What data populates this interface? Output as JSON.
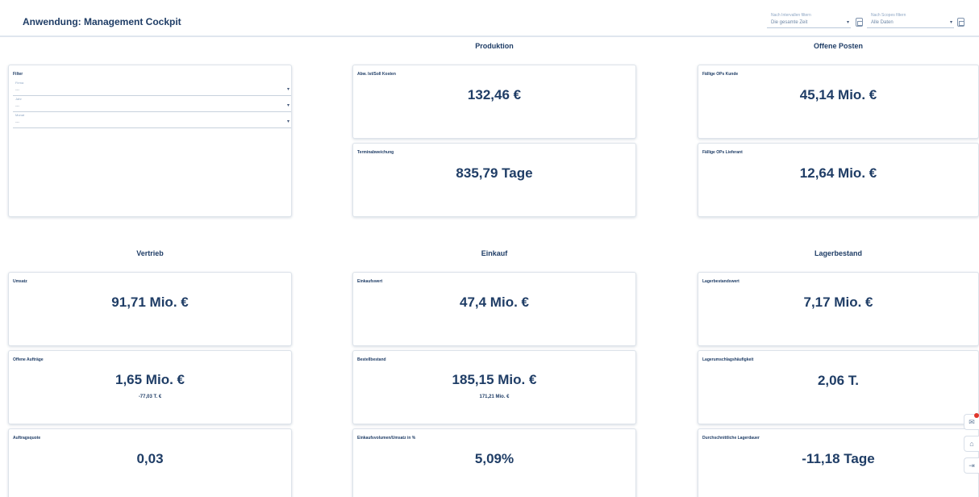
{
  "header": {
    "title": "Anwendung: Management Cockpit",
    "interval_filter": {
      "label": "Nach Intervallen filtern",
      "value": "Die gesamte Zeit"
    },
    "scope_filter": {
      "label": "Nach Scopes filtern",
      "value": "Alle Daten"
    }
  },
  "sections": {
    "produktion": "Produktion",
    "offene_posten": "Offene Posten",
    "vertrieb": "Vertrieb",
    "einkauf": "Einkauf",
    "lagerbestand": "Lagerbestand"
  },
  "filter": {
    "title": "Filter",
    "fields": [
      {
        "label": "Firma",
        "value": "---"
      },
      {
        "label": "Jahr",
        "value": "---"
      },
      {
        "label": "Monat",
        "value": "---"
      }
    ]
  },
  "kpis": {
    "abw_kosten": {
      "label": "Abw. Ist/Soll Kosten",
      "value": "132,46 €"
    },
    "terminabweichung": {
      "label": "Terminabweichung",
      "value": "835,79 Tage"
    },
    "ops_kunde": {
      "label": "Fällige OPs Kunde",
      "value": "45,14 Mio. €"
    },
    "ops_lieferant": {
      "label": "Fällige OPs Lieferant",
      "value": "12,64 Mio. €"
    },
    "umsatz": {
      "label": "Umsatz",
      "value": "91,71 Mio. €"
    },
    "offene_auftraege": {
      "label": "Offene Aufträge",
      "value": "1,65 Mio. €",
      "sub": "-77,03 T. €"
    },
    "auftragsquote": {
      "label": "Auftragsquote",
      "value": "0,03"
    },
    "einkaufswert": {
      "label": "Einkaufswert",
      "value": "47,4 Mio. €"
    },
    "bestellbestand": {
      "label": "Bestellbestand",
      "value": "185,15 Mio. €",
      "sub": "171,21 Mio. €"
    },
    "einkaufsvolumen": {
      "label": "Einkaufsvolumen/Umsatz in %",
      "value": "5,09%"
    },
    "lagerbestandswert": {
      "label": "Lagerbestandswert",
      "value": "7,17 Mio. €"
    },
    "lagerumschlag": {
      "label": "Lagerumschlagshäufigkeit",
      "value": "2,06 T."
    },
    "lagerdauer": {
      "label": "Durchschnittliche Lagerdauer",
      "value": "-11,18 Tage"
    }
  },
  "sidebar_icons": [
    "notification-icon",
    "home-icon",
    "logout-icon"
  ],
  "colors": {
    "primary_text": "#1f3d66",
    "badge": "#e0352b",
    "border": "#dde3ea"
  }
}
